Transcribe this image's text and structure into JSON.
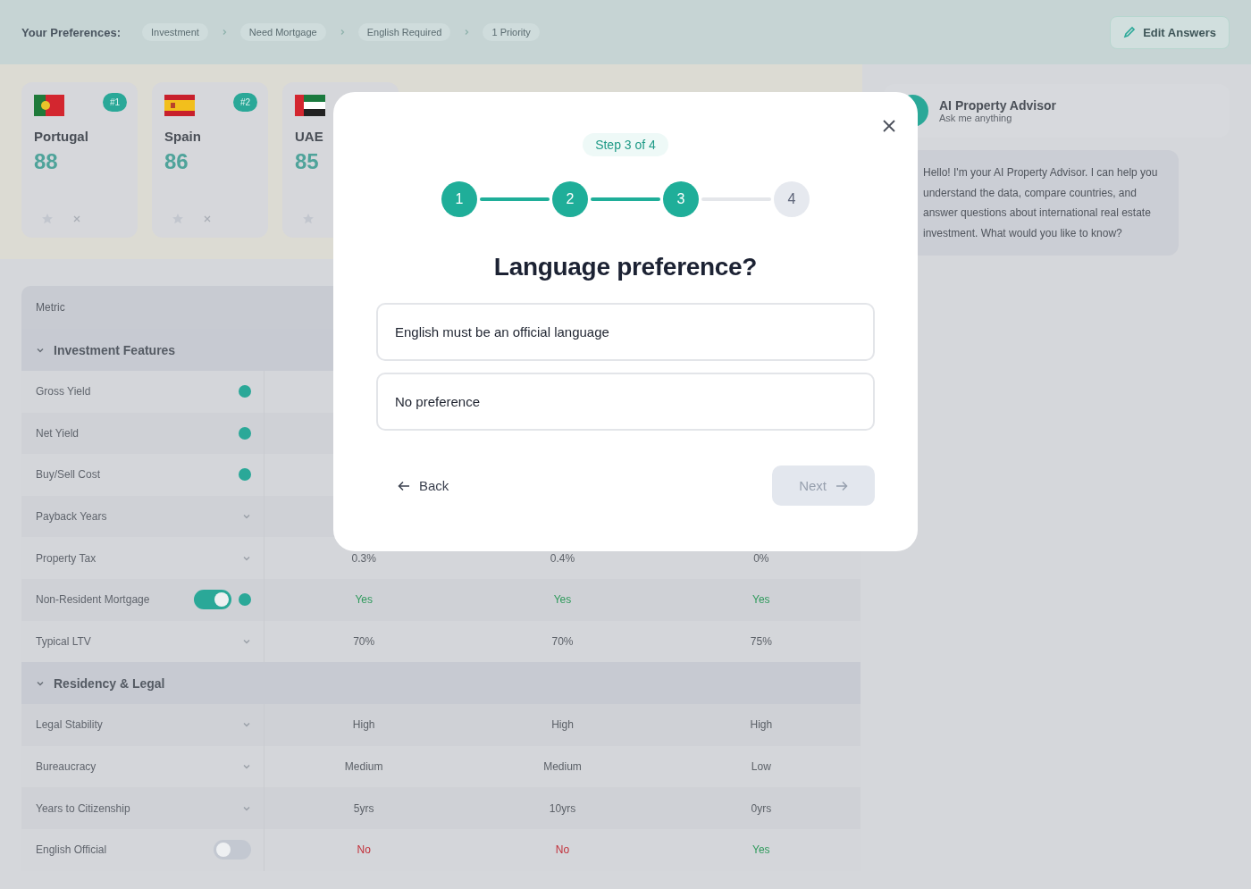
{
  "header": {
    "label": "Your Preferences:",
    "chips": [
      "Investment",
      "Need Mortgage",
      "English Required",
      "1 Priority"
    ],
    "edit_button": "Edit Answers"
  },
  "country_cards": [
    {
      "kind": "portugal",
      "name": "Portugal",
      "score": "88",
      "badge": "#1",
      "icons": [
        {
          "kind": "star"
        },
        {
          "kind": "close"
        }
      ]
    },
    {
      "kind": "spain",
      "name": "Spain",
      "score": "86",
      "badge": "#2",
      "icons": [
        {
          "kind": "star"
        },
        {
          "kind": "close"
        }
      ]
    },
    {
      "kind": "uae",
      "name": "UAE",
      "score": "85",
      "icons": [
        {
          "kind": "star"
        }
      ]
    }
  ],
  "table": {
    "header": "Metric",
    "sections": [
      {
        "title": "Investment Features",
        "expanded": true,
        "rows": [
          {
            "label": "Gross Yield",
            "kind": "dot"
          },
          {
            "label": "Net Yield",
            "kind": "dot"
          },
          {
            "label": "Buy/Sell Cost",
            "kind": "dot"
          },
          {
            "label": "Payback Years",
            "kind": "chevron"
          },
          {
            "label": "Property Tax",
            "kind": "chevron",
            "cells": [
              {
                "text": "0.3%"
              },
              {
                "text": "0.4%"
              },
              {
                "text": "0%"
              }
            ]
          },
          {
            "label": "Non-Resident Mortgage",
            "kind": "toggle",
            "on": true,
            "cells": [
              {
                "text": "Yes",
                "color": "#2f9a5c"
              },
              {
                "text": "Yes",
                "color": "#2f9a5c"
              },
              {
                "text": "Yes",
                "color": "#2f9a5c"
              }
            ]
          },
          {
            "label": "Typical LTV",
            "kind": "chevron",
            "cells": [
              {
                "text": "70%"
              },
              {
                "text": "70%"
              },
              {
                "text": "75%"
              }
            ]
          }
        ]
      },
      {
        "title": "Residency & Legal",
        "expanded": true,
        "rows": [
          {
            "label": "Legal Stability",
            "kind": "chevron",
            "cells": [
              {
                "text": "High"
              },
              {
                "text": "High"
              },
              {
                "text": "High"
              }
            ]
          },
          {
            "label": "Bureaucracy",
            "kind": "chevron",
            "cells": [
              {
                "text": "Medium"
              },
              {
                "text": "Medium"
              },
              {
                "text": "Low"
              }
            ]
          },
          {
            "label": "Years to Citizenship",
            "kind": "chevron",
            "cells": [
              {
                "text": "5yrs"
              },
              {
                "text": "10yrs"
              },
              {
                "text": "0yrs"
              }
            ]
          },
          {
            "label": "English Official",
            "kind": "toggle",
            "on": false,
            "cells": [
              {
                "text": "No",
                "color": "#c2303a"
              },
              {
                "text": "No",
                "color": "#c2303a"
              },
              {
                "text": "Yes",
                "color": "#2f9a5c"
              }
            ]
          }
        ]
      }
    ]
  },
  "advisor": {
    "title": "AI Property Advisor",
    "subtitle": "Ask me anything",
    "message": "Hello! I'm your AI Property Advisor. I can help you understand the data, compare countries, and answer questions about international real estate investment. What would you like to know?"
  },
  "modal": {
    "step_label": "Step 3 of 4",
    "steps": [
      {
        "label": "1",
        "completed": true
      },
      {
        "label": "2",
        "completed": true
      },
      {
        "label": "3",
        "completed": true
      },
      {
        "label": "4",
        "completed": false
      }
    ],
    "question": "Language preference?",
    "options": [
      {
        "label": "English must be an official language",
        "selected": false
      },
      {
        "label": "No preference",
        "selected": false
      }
    ],
    "back": "Back",
    "next": {
      "label": "Next",
      "disabled": true
    }
  }
}
